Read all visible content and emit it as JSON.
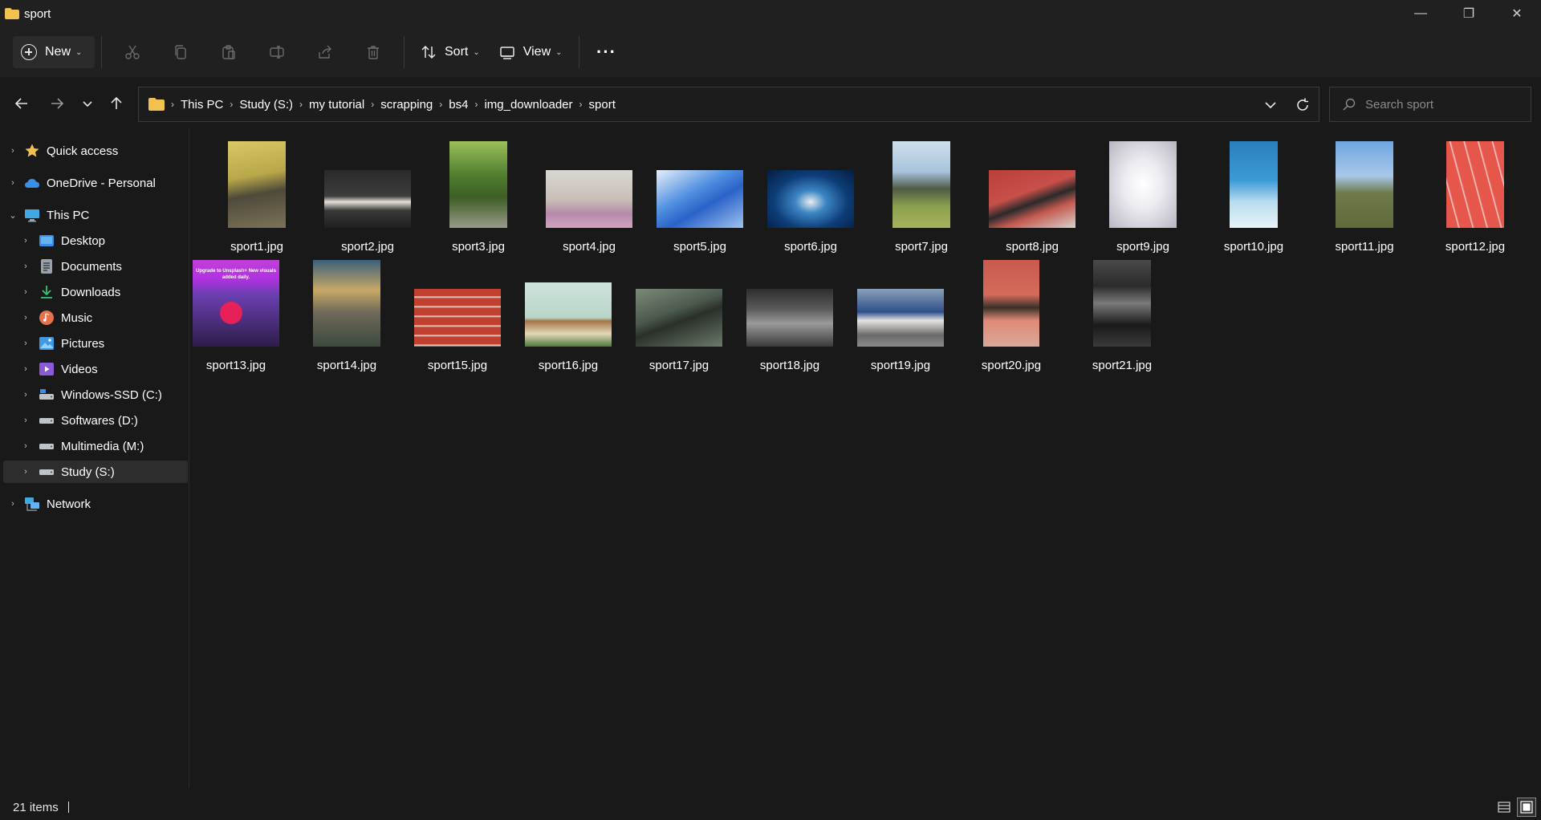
{
  "window": {
    "title": "sport",
    "minimize_label": "—",
    "maximize_label": "❐",
    "close_label": "✕"
  },
  "commandbar": {
    "new_label": "New",
    "sort_label": "Sort",
    "view_label": "View",
    "more_label": "···"
  },
  "address": {
    "crumbs": [
      "This PC",
      "Study (S:)",
      "my tutorial",
      "scrapping",
      "bs4",
      "img_downloader",
      "sport"
    ],
    "separator": "›"
  },
  "search": {
    "placeholder": "Search sport"
  },
  "sidebar": {
    "items": [
      {
        "label": "Quick access",
        "icon": "star-icon"
      },
      {
        "label": "OneDrive - Personal",
        "icon": "cloud-icon"
      },
      {
        "label": "This PC",
        "icon": "monitor-icon"
      },
      {
        "label": "Desktop",
        "icon": "desktop-icon"
      },
      {
        "label": "Documents",
        "icon": "document-icon"
      },
      {
        "label": "Downloads",
        "icon": "download-icon"
      },
      {
        "label": "Music",
        "icon": "music-icon"
      },
      {
        "label": "Pictures",
        "icon": "pictures-icon"
      },
      {
        "label": "Videos",
        "icon": "video-icon"
      },
      {
        "label": "Windows-SSD (C:)",
        "icon": "drive-icon"
      },
      {
        "label": "Softwares (D:)",
        "icon": "drive-icon"
      },
      {
        "label": "Multimedia (M:)",
        "icon": "drive-icon"
      },
      {
        "label": "Study (S:)",
        "icon": "drive-icon"
      },
      {
        "label": "Network",
        "icon": "network-icon"
      }
    ],
    "selected": "Study (S:)"
  },
  "files": [
    {
      "name": "sport1.jpg"
    },
    {
      "name": "sport2.jpg"
    },
    {
      "name": "sport3.jpg"
    },
    {
      "name": "sport4.jpg"
    },
    {
      "name": "sport5.jpg"
    },
    {
      "name": "sport6.jpg"
    },
    {
      "name": "sport7.jpg"
    },
    {
      "name": "sport8.jpg"
    },
    {
      "name": "sport9.jpg"
    },
    {
      "name": "sport10.jpg"
    },
    {
      "name": "sport11.jpg"
    },
    {
      "name": "sport12.jpg"
    },
    {
      "name": "sport13.jpg",
      "thumb_text": "Upgrade to Unsplash+ New visuals added daily."
    },
    {
      "name": "sport14.jpg"
    },
    {
      "name": "sport15.jpg"
    },
    {
      "name": "sport16.jpg"
    },
    {
      "name": "sport17.jpg"
    },
    {
      "name": "sport18.jpg"
    },
    {
      "name": "sport19.jpg"
    },
    {
      "name": "sport20.jpg"
    },
    {
      "name": "sport21.jpg"
    }
  ],
  "status": {
    "item_count": "21 items"
  },
  "colors": {
    "background": "#191919",
    "chrome": "#202020",
    "accent_folder": "#f2c14e",
    "selection": "#2d2d2d"
  }
}
